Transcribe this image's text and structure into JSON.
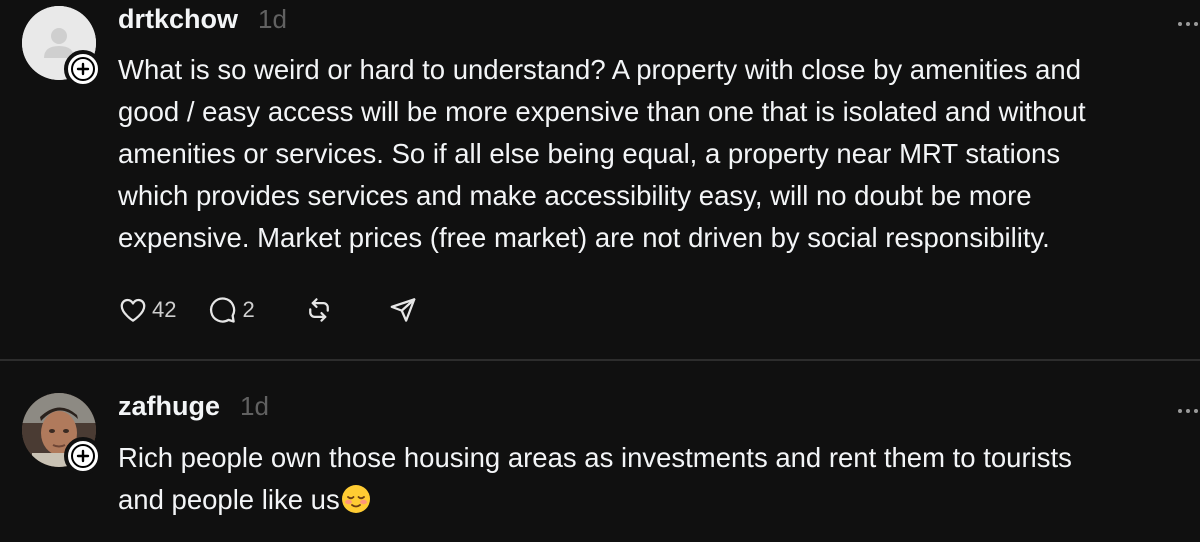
{
  "posts": [
    {
      "username": "drtkchow",
      "time": "1d",
      "lines": [
        "What is so weird or hard to understand? A property with close by amenities and",
        "good / easy access will be more expensive than one that is isolated and without",
        "amenities or services. So if all else being equal, a property near MRT stations",
        "which provides services and make accessibility easy, will no doubt be more",
        "expensive. Market prices (free market) are not driven by social responsibility."
      ],
      "likes": "42",
      "replies": "2",
      "avatar": "default-person-icon"
    },
    {
      "username": "zafhuge",
      "time": "1d",
      "lines": [
        "Rich people own those housing areas as investments and rent them to tourists",
        "and people like us"
      ],
      "emoji": "relieved-face-emoji",
      "avatar": "photo-avatar"
    }
  ],
  "colors": {
    "background": "#101010",
    "text": "#f3f5f7",
    "muted": "#616161",
    "divider": "#2d2d2d"
  }
}
